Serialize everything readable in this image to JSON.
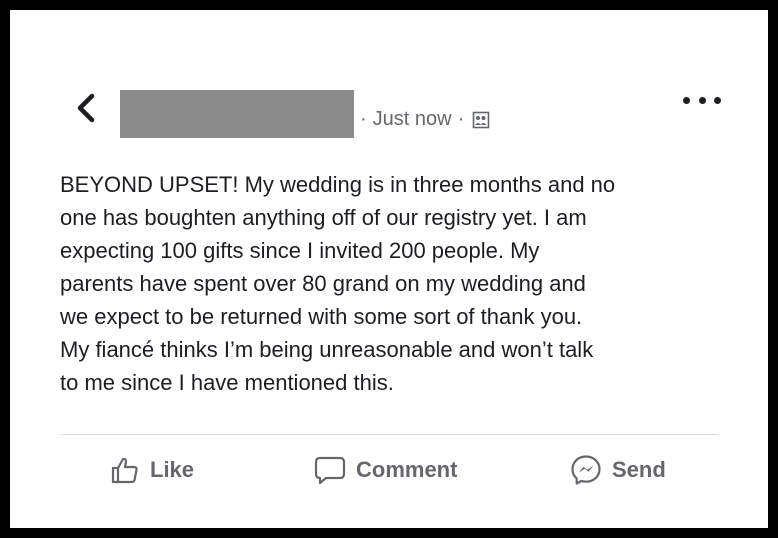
{
  "header": {
    "timestamp": "Just now",
    "separator": "·",
    "audience_icon": "friends-audience-icon"
  },
  "post": {
    "lines": [
      "BEYOND UPSET! My wedding is in three months and no",
      "one has boughten anything off of our registry yet. I am",
      "expecting 100 gifts since I invited 200 people. My",
      "parents have spent over 80 grand on my wedding and",
      "we expect to be returned with some sort of thank you.",
      "My fiancé thinks I’m being unreasonable and won’t talk",
      "to me since I have mentioned this."
    ]
  },
  "actions": {
    "like_label": "Like",
    "comment_label": "Comment",
    "send_label": "Send"
  },
  "icons": {
    "back": "chevron-left-icon",
    "more": "more-horizontal-icon",
    "like": "thumbs-up-icon",
    "comment": "speech-bubble-icon",
    "send": "messenger-icon"
  },
  "colors": {
    "frame": "#000000",
    "card": "#ffffff",
    "text": "#1c1e21",
    "muted": "#65676b",
    "redaction": "#8c8c8c"
  }
}
